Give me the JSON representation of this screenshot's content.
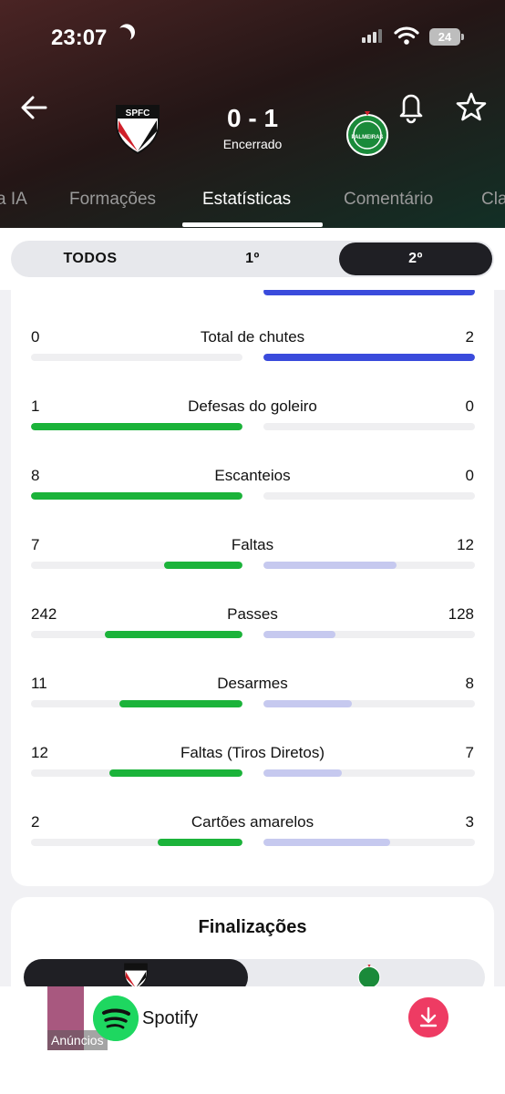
{
  "status_bar": {
    "time": "23:07",
    "battery": "24"
  },
  "match": {
    "home_team_crest_text": "SPFC",
    "away_team_crest_text": "PALMEIRAS",
    "score": "0 - 1",
    "status": "Encerrado"
  },
  "tabs": [
    {
      "label": "a IA"
    },
    {
      "label": "Formações"
    },
    {
      "label": "Estatísticas",
      "active": true
    },
    {
      "label": "Comentário"
    },
    {
      "label": "Cla"
    }
  ],
  "period_filter": [
    {
      "label": "TODOS"
    },
    {
      "label": "1º"
    },
    {
      "label": "2º",
      "active": true
    }
  ],
  "stats": [
    {
      "label": "Total de chutes",
      "home": "0",
      "away": "2",
      "home_share": 0,
      "away_share": 1,
      "away_lead": true
    },
    {
      "label": "Defesas do goleiro",
      "home": "1",
      "away": "0",
      "home_share": 1,
      "away_share": 0
    },
    {
      "label": "Escanteios",
      "home": "8",
      "away": "0",
      "home_share": 1,
      "away_share": 0
    },
    {
      "label": "Faltas",
      "home": "7",
      "away": "12",
      "home_share": 0.37,
      "away_share": 0.63
    },
    {
      "label": "Passes",
      "home": "242",
      "away": "128",
      "home_share": 0.65,
      "away_share": 0.34
    },
    {
      "label": "Desarmes",
      "home": "11",
      "away": "8",
      "home_share": 0.58,
      "away_share": 0.42
    },
    {
      "label": "Faltas (Tiros Diretos)",
      "home": "12",
      "away": "7",
      "home_share": 0.63,
      "away_share": 0.37
    },
    {
      "label": "Cartões amarelos",
      "home": "2",
      "away": "3",
      "home_share": 0.4,
      "away_share": 0.6
    }
  ],
  "finalizacoes": {
    "title": "Finalizações"
  },
  "ad": {
    "label": "Anúncios",
    "app_name": "Spotify"
  },
  "colors": {
    "home_bar": "#1bb33a",
    "away_bar": "#c6c9ef",
    "away_lead_bar": "#3a4bdc",
    "download": "#ee3b63"
  }
}
